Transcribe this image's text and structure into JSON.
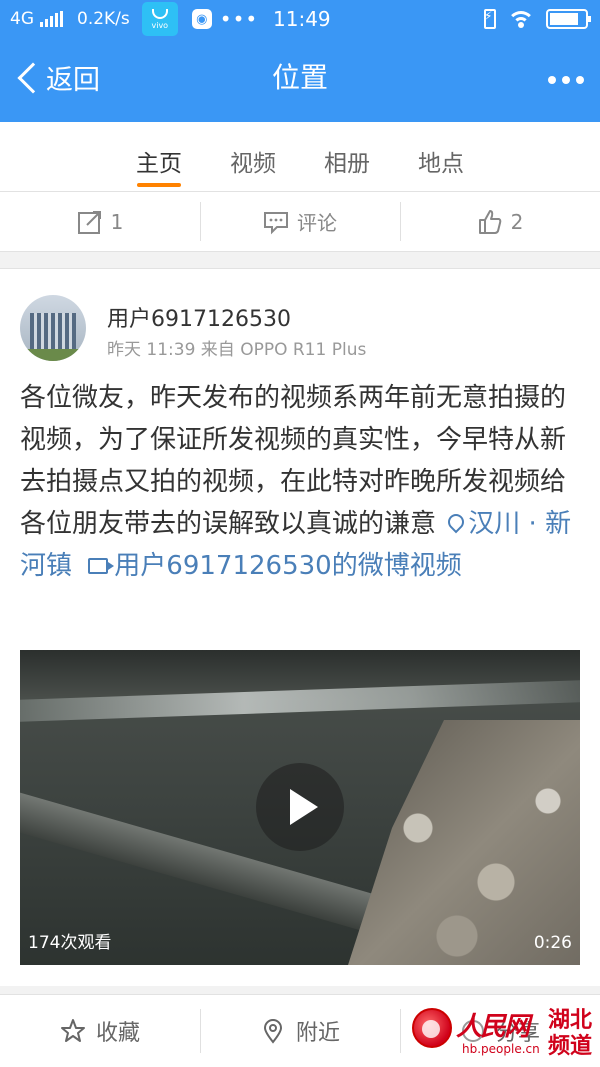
{
  "status_bar": {
    "network": "4G",
    "speed": "0.2K/s",
    "vivo_label": "vivo",
    "time": "11:49"
  },
  "header": {
    "back_label": "返回",
    "title": "位置"
  },
  "tabs": [
    {
      "label": "主页",
      "active": true
    },
    {
      "label": "视频",
      "active": false
    },
    {
      "label": "相册",
      "active": false
    },
    {
      "label": "地点",
      "active": false
    }
  ],
  "actions": {
    "repost_count": "1",
    "comment_label": "评论",
    "like_count": "2"
  },
  "post": {
    "username": "用户6917126530",
    "meta": "昨天 11:39 来自 OPPO R11 Plus",
    "text": "各位微友，昨天发布的视频系两年前无意拍摄的视频，为了保证所发视频的真实性，今早特从新去拍摄点又拍的视频，在此特对昨晚所发视频给各位朋友带去的误解致以真诚的谦意",
    "location_link": "汉川 · 新河镇",
    "video_link": "用户6917126530的微博视频",
    "video": {
      "views": "174次观看",
      "duration": "0:26"
    }
  },
  "bottom_bar": {
    "favorite_label": "收藏",
    "nearby_label": "附近",
    "share_label": "分享"
  },
  "watermark": {
    "brand": "人民网",
    "url": "hb.people.cn",
    "category": "湖北频道"
  },
  "colors": {
    "brand_blue": "#3a97f5",
    "tab_accent": "#ff8200",
    "link_blue": "#4a7fb8",
    "watermark_red": "#d0021b"
  }
}
